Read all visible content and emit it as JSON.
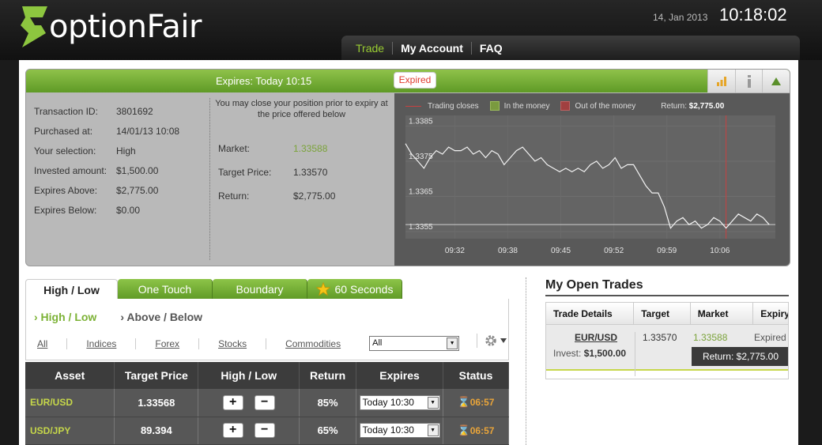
{
  "brand": {
    "name": "optionFair",
    "accent": "#8dc63f"
  },
  "header": {
    "date": "14, Jan 2013",
    "time": "10:18:02"
  },
  "nav": {
    "items": [
      "Trade",
      "My Account",
      "FAQ"
    ],
    "active": "Trade"
  },
  "panel": {
    "expires_label": "Expires:  Today 10:15",
    "status_badge": "Expired",
    "tools": [
      "bar-chart-icon",
      "info-icon",
      "collapse-up-icon"
    ],
    "transaction": [
      {
        "label": "Transaction ID:",
        "value": "3801692"
      },
      {
        "label": "Purchased at:",
        "value": "14/01/13 10:08"
      },
      {
        "label": "Your selection:",
        "value": "High"
      },
      {
        "label": "Invested amount:",
        "value": "$1,500.00"
      },
      {
        "label": "Expires Above:",
        "value": "$2,775.00"
      },
      {
        "label": "Expires Below:",
        "value": "$0.00"
      }
    ],
    "close_note": "You may close your position prior to expiry at the price offered below",
    "close_rows": [
      {
        "label": "Market:",
        "value": "1.33588"
      },
      {
        "label": "Target Price:",
        "value": "1.33570"
      },
      {
        "label": "Return:",
        "value": "$2,775.00"
      }
    ]
  },
  "chart_data": {
    "type": "line",
    "legend": [
      "Trading closes",
      "In the money",
      "Out of the money"
    ],
    "legend_colors": [
      "#c84040",
      "#7a9a3f",
      "#a14040"
    ],
    "return_label": "Return:",
    "return_value": "$2,775.00",
    "yticks": [
      "1.3385",
      "1.3375",
      "1.3365",
      "1.3355"
    ],
    "ylim": [
      1.3353,
      1.3388
    ],
    "xticks": [
      "09:32",
      "09:38",
      "09:45",
      "09:52",
      "09:59",
      "10:06"
    ],
    "xlim": [
      0,
      60
    ],
    "target": 1.3357,
    "trading_closes_x": 52,
    "points": [
      [
        0,
        1.338
      ],
      [
        1,
        1.3377
      ],
      [
        2,
        1.3375
      ],
      [
        3,
        1.3373
      ],
      [
        4,
        1.3376
      ],
      [
        5,
        1.3378
      ],
      [
        6,
        1.3377
      ],
      [
        7,
        1.3379
      ],
      [
        8,
        1.3378
      ],
      [
        9,
        1.3378
      ],
      [
        10,
        1.3379
      ],
      [
        11,
        1.3377
      ],
      [
        12,
        1.3378
      ],
      [
        13,
        1.3376
      ],
      [
        14,
        1.3378
      ],
      [
        15,
        1.3377
      ],
      [
        16,
        1.3374
      ],
      [
        17,
        1.3376
      ],
      [
        18,
        1.3378
      ],
      [
        19,
        1.3379
      ],
      [
        20,
        1.3377
      ],
      [
        21,
        1.3375
      ],
      [
        22,
        1.3376
      ],
      [
        23,
        1.3374
      ],
      [
        24,
        1.3373
      ],
      [
        25,
        1.3372
      ],
      [
        26,
        1.3373
      ],
      [
        27,
        1.3372
      ],
      [
        28,
        1.3373
      ],
      [
        29,
        1.3372
      ],
      [
        30,
        1.3374
      ],
      [
        31,
        1.3375
      ],
      [
        32,
        1.3373
      ],
      [
        33,
        1.3374
      ],
      [
        34,
        1.3376
      ],
      [
        35,
        1.3373
      ],
      [
        36,
        1.3374
      ],
      [
        37,
        1.3374
      ],
      [
        38,
        1.3371
      ],
      [
        39,
        1.3368
      ],
      [
        40,
        1.3366
      ],
      [
        41,
        1.3366
      ],
      [
        42,
        1.3362
      ],
      [
        43,
        1.3356
      ],
      [
        44,
        1.3358
      ],
      [
        45,
        1.3359
      ],
      [
        46,
        1.3357
      ],
      [
        47,
        1.3358
      ],
      [
        48,
        1.3356
      ],
      [
        49,
        1.3357
      ],
      [
        50,
        1.3359
      ],
      [
        51,
        1.3358
      ],
      [
        52,
        1.3356
      ],
      [
        53,
        1.3358
      ],
      [
        54,
        1.336
      ],
      [
        55,
        1.3359
      ],
      [
        56,
        1.3358
      ],
      [
        57,
        1.336
      ],
      [
        58,
        1.3359
      ],
      [
        59,
        1.3357
      ]
    ]
  },
  "tabs": [
    {
      "label": "High / Low",
      "active": true
    },
    {
      "label": "One Touch"
    },
    {
      "label": "Boundary"
    },
    {
      "label": "60 Seconds",
      "icon": "star-icon"
    }
  ],
  "subtabs": [
    "› High / Low",
    "› Above / Below"
  ],
  "filters": [
    "All",
    "Indices",
    "Forex",
    "Stocks",
    "Commodities"
  ],
  "asset_select": "All",
  "table": {
    "headers": [
      "Asset",
      "Target Price",
      "High / Low",
      "Return",
      "Expires",
      "Status"
    ],
    "rows": [
      {
        "asset": "EUR/USD",
        "target": "1.33568",
        "return": "85%",
        "expires": "Today 10:30",
        "status": "06:57"
      },
      {
        "asset": "USD/JPY",
        "target": "89.394",
        "return": "65%",
        "expires": "Today 10:30",
        "status": "06:57"
      }
    ]
  },
  "open_trades": {
    "title": "My Open Trades",
    "headers": [
      "Trade Details",
      "Target",
      "Market",
      "Expiry"
    ],
    "trade": {
      "asset": "EUR/USD",
      "invest_label": "Invest:",
      "invest": "$1,500.00",
      "target": "1.33570",
      "market": "1.33588",
      "expiry": "Expired",
      "return": "Return: $2,775.00"
    }
  }
}
